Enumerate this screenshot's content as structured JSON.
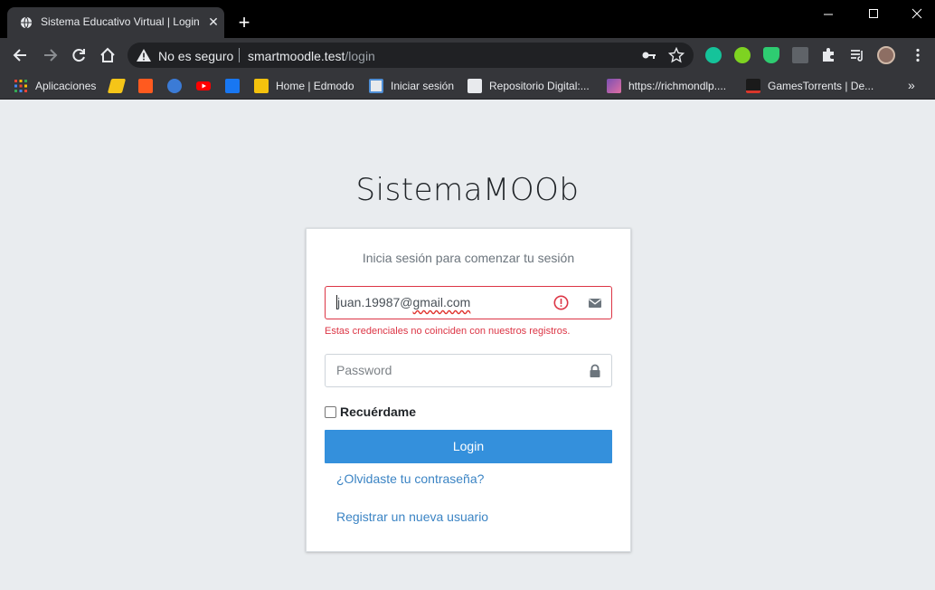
{
  "browser": {
    "tab_title": "Sistema Educativo Virtual | Login",
    "new_tab_label": "+",
    "security_label": "No es seguro",
    "url_host": "smartmoodle.test",
    "url_path": "/login",
    "bookmarks": [
      {
        "label": "Aplicaciones",
        "icon": "apps-grid-icon",
        "color": "#ea4335"
      },
      {
        "label": "",
        "icon": "yellow-logo-icon",
        "color": "#f5c518"
      },
      {
        "label": "",
        "icon": "af-icon",
        "color": "#ff5a1f"
      },
      {
        "label": "",
        "icon": "chat-icon",
        "color": "#3b7bd6"
      },
      {
        "label": "",
        "icon": "youtube-icon",
        "color": "#ff0000"
      },
      {
        "label": "",
        "icon": "facebook-icon",
        "color": "#1877f2"
      },
      {
        "label": "Home | Edmodo",
        "icon": "edmodo-icon",
        "color": "#f4c20d"
      },
      {
        "label": "Iniciar sesión",
        "icon": "login-page-icon",
        "color": "#4f8fd6"
      },
      {
        "label": "Repositorio Digital:...",
        "icon": "d-letter-icon",
        "color": "#e8eaed"
      },
      {
        "label": "https://richmondlp....",
        "icon": "richmond-icon",
        "color": "#7b4fb3"
      },
      {
        "label": "GamesTorrents | De...",
        "icon": "gamestorrents-icon",
        "color": "#d9362b"
      }
    ],
    "bookmarks_more": "»"
  },
  "page": {
    "brand": "SistemaMOOb",
    "login_message": "Inicia sesión para comenzar tu sesión",
    "email_value_plain": "juan.19987@",
    "email_value_underlined": "gmail.com",
    "email_error": "Estas credenciales no coinciden con nuestros registros.",
    "password_placeholder": "Password",
    "remember_label": "Recuérdame",
    "login_button": "Login",
    "forgot_link": "¿Olvidaste tu contraseña?",
    "register_link": "Registrar un nueva usuario"
  },
  "colors": {
    "primary": "#3490dc",
    "error": "#dc3545",
    "link": "#3b84c4"
  }
}
